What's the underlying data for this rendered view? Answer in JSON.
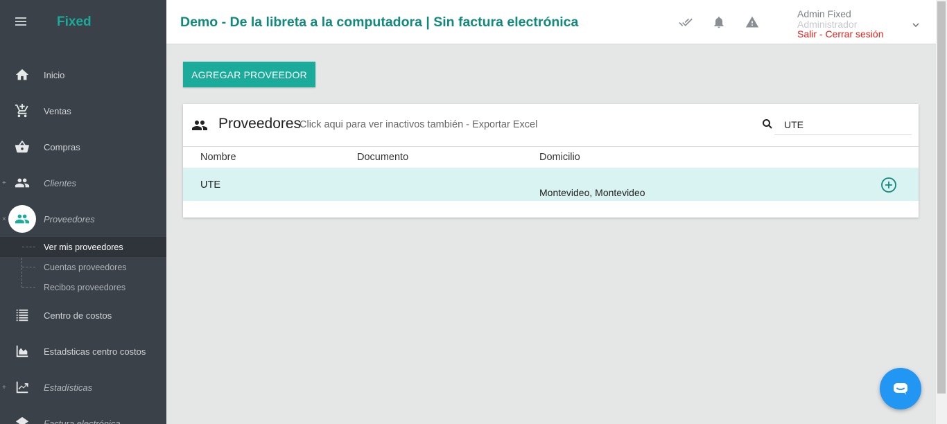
{
  "app": {
    "brand": "Fixed"
  },
  "sidebar": {
    "items": [
      {
        "label": "Inicio",
        "icon": "home-icon"
      },
      {
        "label": "Ventas",
        "icon": "cart-icon"
      },
      {
        "label": "Compras",
        "icon": "basket-icon"
      },
      {
        "label": "Clientes",
        "icon": "people-icon",
        "expander": "+"
      },
      {
        "label": "Proveedores",
        "icon": "people-icon",
        "expander": "×"
      }
    ],
    "sub_items": [
      {
        "label": "Ver mis proveedores"
      },
      {
        "label": "Cuentas proveedores"
      },
      {
        "label": "Recibos proveedores"
      }
    ],
    "items_after": [
      {
        "label": "Centro de costos",
        "icon": "list-icon"
      },
      {
        "label": "Estadsticas centro costos",
        "icon": "area-chart-icon"
      },
      {
        "label": "Estadísticas",
        "icon": "trending-up-icon",
        "expander": "+"
      },
      {
        "label": "Factura electrónica",
        "icon": "invoice-icon"
      }
    ]
  },
  "header": {
    "title": "Demo - De la libreta a la computadora | Sin factura electrónica",
    "user": {
      "name": "Admin Fixed",
      "role": "Administrador",
      "logout": "Salir - Cerrar sesión"
    }
  },
  "main": {
    "add_button": "AGREGAR PROVEEDOR",
    "card": {
      "title": "Proveedores",
      "link": "Click aqui para ver inactivos también - Exportar Excel",
      "search_value": "UTE",
      "columns": [
        "Nombre",
        "Documento",
        "Domicilio"
      ],
      "rows": [
        {
          "nombre": "UTE",
          "documento": "",
          "domicilio": "Montevideo, Montevideo"
        }
      ]
    }
  },
  "colors": {
    "accent": "#1aab9b",
    "title": "#11897d",
    "sidebar_bg": "#3a4149",
    "row_highlight": "#d8f3f1",
    "logout": "#e0201b",
    "chat": "#2196f3"
  }
}
